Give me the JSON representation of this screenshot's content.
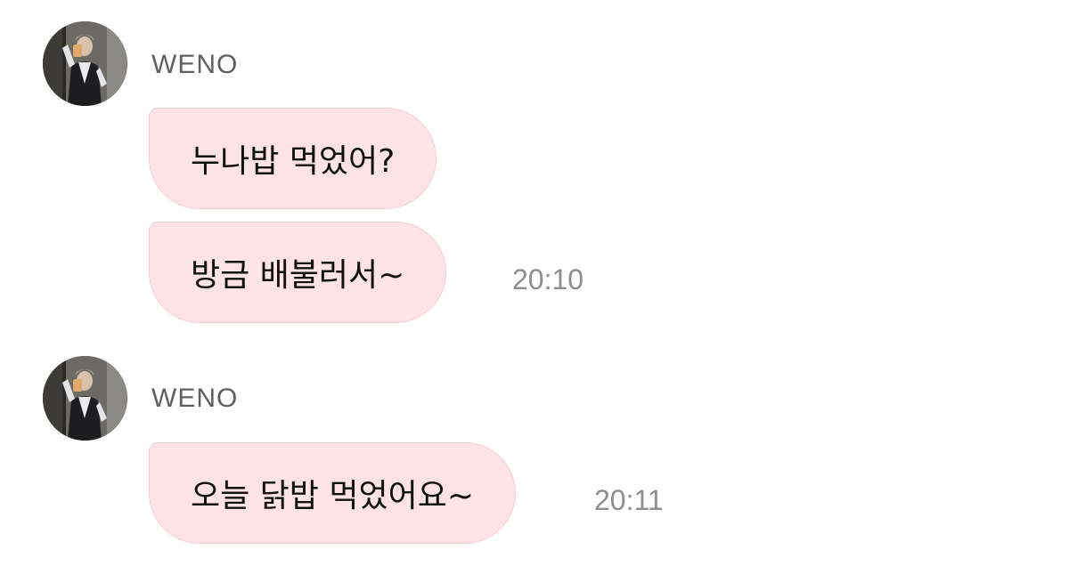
{
  "chat": {
    "groups": [
      {
        "sender": "WENO",
        "avatar_icon": "profile-photo",
        "messages": [
          {
            "text": "누나밥 먹었어?"
          },
          {
            "text": "방금 배불러서~",
            "time": "20:10"
          }
        ]
      },
      {
        "sender": "WENO",
        "avatar_icon": "profile-photo",
        "messages": [
          {
            "text": "오늘 닭밥 먹었어요~",
            "time": "20:11"
          }
        ]
      }
    ]
  },
  "colors": {
    "bubble_bg": "#fde3e8",
    "bubble_border": "#f7ccd5",
    "sender_text": "#5f5f5f",
    "timestamp_text": "#8e8e8e"
  }
}
